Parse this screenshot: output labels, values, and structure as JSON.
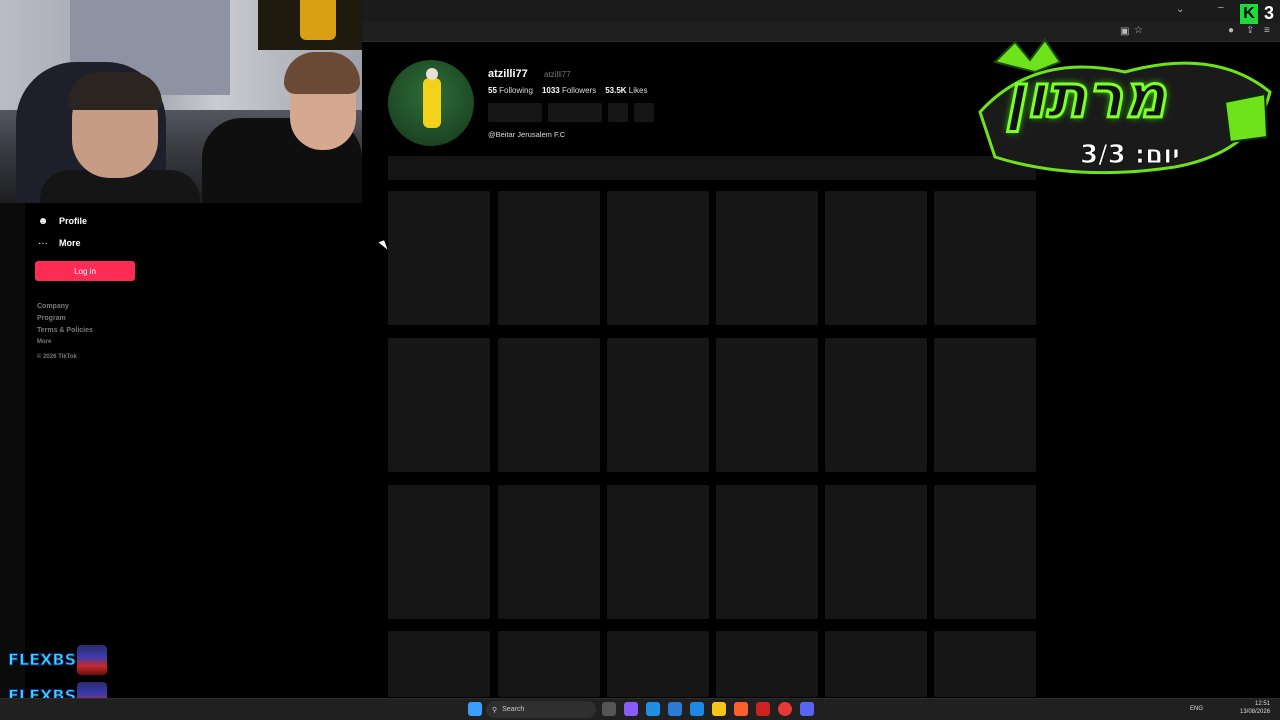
{
  "nav": {
    "profile_label": "Profile",
    "more_label": "More",
    "login_label": "Log in",
    "footer": [
      "Company",
      "Program",
      "Terms & Policies",
      "More"
    ],
    "copyright": "© 2026 TikTok"
  },
  "profile": {
    "username": "atzilli77",
    "nickname": "atzilli77",
    "following_count": "55",
    "following_label": "Following",
    "followers_count": "1033",
    "followers_label": "Followers",
    "likes_count": "53.5K",
    "likes_label": "Likes",
    "bio": "@Beitar Jerusalem F.C"
  },
  "overlay": {
    "logo_title": "מרתון",
    "logo_sub": "יום: 3/3",
    "flexbs_1": "FLEXBS:",
    "flexbs_2": "FLEXBS:",
    "badge_k": "K",
    "badge_number": "3"
  },
  "taskbar": {
    "search_label": "Search",
    "lang": "ENG",
    "time": "12:51",
    "date": "13/08/2026"
  },
  "colors": {
    "accent": "#fe2c55",
    "logo_green": "#7cff2a"
  }
}
